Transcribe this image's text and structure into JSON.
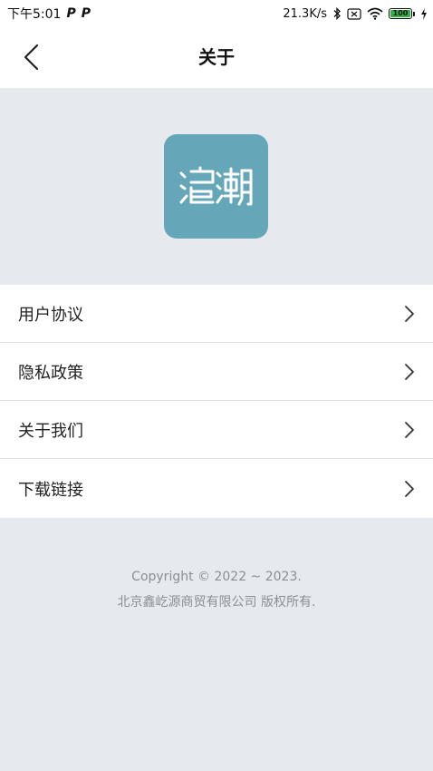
{
  "status_bar": {
    "time": "下午5:01",
    "notification_icons": [
      "P",
      "P"
    ],
    "network_speed": "21.3K/s",
    "battery_level": "100",
    "icons": [
      "bluetooth-icon",
      "sim-icon",
      "wifi-icon",
      "battery-icon",
      "charging-icon"
    ]
  },
  "nav": {
    "title": "关于"
  },
  "logo": {
    "color": "#65a7b9"
  },
  "menu": {
    "items": [
      {
        "label": "用户协议"
      },
      {
        "label": "隐私政策"
      },
      {
        "label": "关于我们"
      },
      {
        "label": "下载链接"
      }
    ]
  },
  "footer": {
    "copyright": "Copyright © 2022 ~ 2023.",
    "company": "北京鑫屹源商贸有限公司 版权所有."
  }
}
